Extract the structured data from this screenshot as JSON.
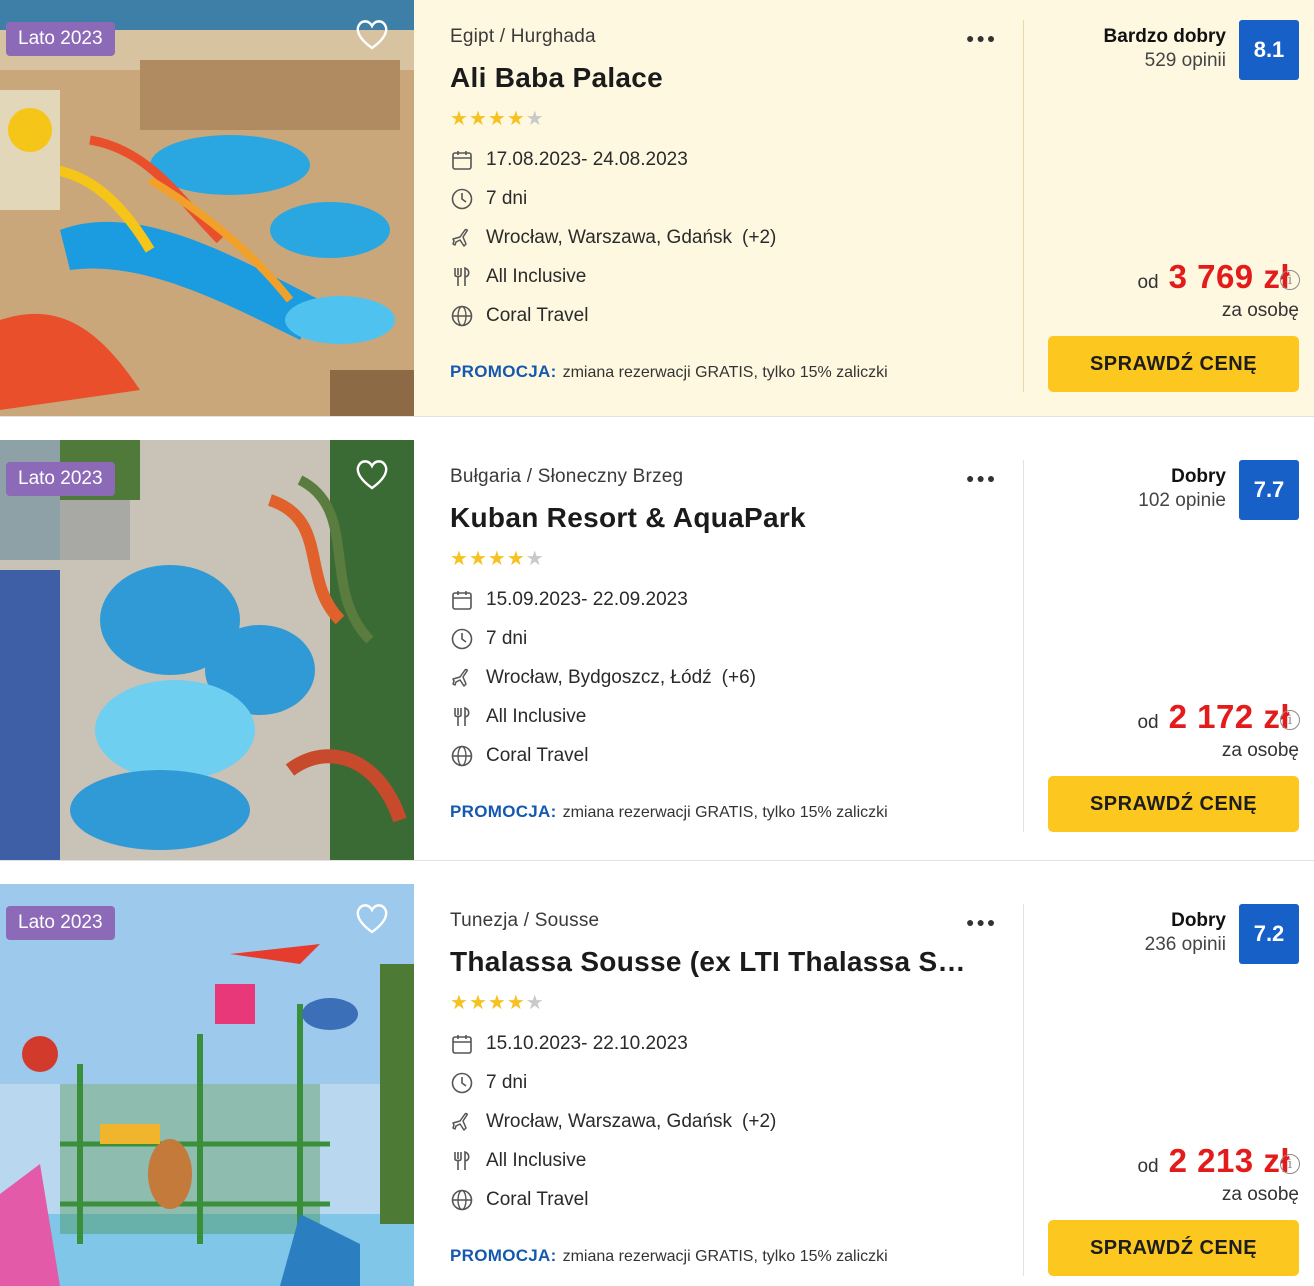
{
  "offers": [
    {
      "badge": "Lato 2023",
      "location": "Egipt / Hurghada",
      "name": "Ali Baba Palace",
      "stars": 4,
      "dates": "17.08.2023- 24.08.2023",
      "duration": "7 dni",
      "airports": "Wrocław, Warszawa, Gdańsk",
      "airports_extra": "(+2)",
      "board": "All Inclusive",
      "operator": "Coral Travel",
      "promo_label": "PROMOCJA:",
      "promo_text": "zmiana rezerwacji GRATIS, tylko 15% zaliczki",
      "rating_word": "Bardzo dobry",
      "rating_count": "529 opinii",
      "rating_score": "8.1",
      "price_from": "od",
      "price": "3 769 zł",
      "per_person": "za osobę",
      "cta": "SPRAWDŹ CENĘ",
      "highlighted": true
    },
    {
      "badge": "Lato 2023",
      "location": "Bułgaria / Słoneczny Brzeg",
      "name": "Kuban Resort & AquaPark",
      "stars": 4,
      "dates": "15.09.2023- 22.09.2023",
      "duration": "7 dni",
      "airports": "Wrocław, Bydgoszcz, Łódź",
      "airports_extra": "(+6)",
      "board": "All Inclusive",
      "operator": "Coral Travel",
      "promo_label": "PROMOCJA:",
      "promo_text": "zmiana rezerwacji GRATIS, tylko 15% zaliczki",
      "rating_word": "Dobry",
      "rating_count": "102 opinie",
      "rating_score": "7.7",
      "price_from": "od",
      "price": "2 172 zł",
      "per_person": "za osobę",
      "cta": "SPRAWDŹ CENĘ",
      "highlighted": false
    },
    {
      "badge": "Lato 2023",
      "location": "Tunezja / Sousse",
      "name": "Thalassa Sousse (ex LTI Thalassa Sousse)",
      "stars": 4,
      "dates": "15.10.2023- 22.10.2023",
      "duration": "7 dni",
      "airports": "Wrocław, Warszawa, Gdańsk",
      "airports_extra": "(+2)",
      "board": "All Inclusive",
      "operator": "Coral Travel",
      "promo_label": "PROMOCJA:",
      "promo_text": "zmiana rezerwacji GRATIS, tylko 15% zaliczki",
      "rating_word": "Dobry",
      "rating_count": "236 opinii",
      "rating_score": "7.2",
      "price_from": "od",
      "price": "2 213 zł",
      "per_person": "za osobę",
      "cta": "SPRAWDŹ CENĘ",
      "highlighted": false
    }
  ],
  "colors": {
    "badge": "#8d6ab8",
    "score": "#1660c7",
    "price": "#e31b1b",
    "cta": "#fcc81f",
    "promo_label": "#1558b0",
    "highlight_bg": "#fff8e1"
  },
  "icons": [
    "heart-icon",
    "more-dots-icon",
    "calendar-icon",
    "clock-icon",
    "plane-icon",
    "cutlery-icon",
    "globe-icon",
    "info-icon"
  ]
}
